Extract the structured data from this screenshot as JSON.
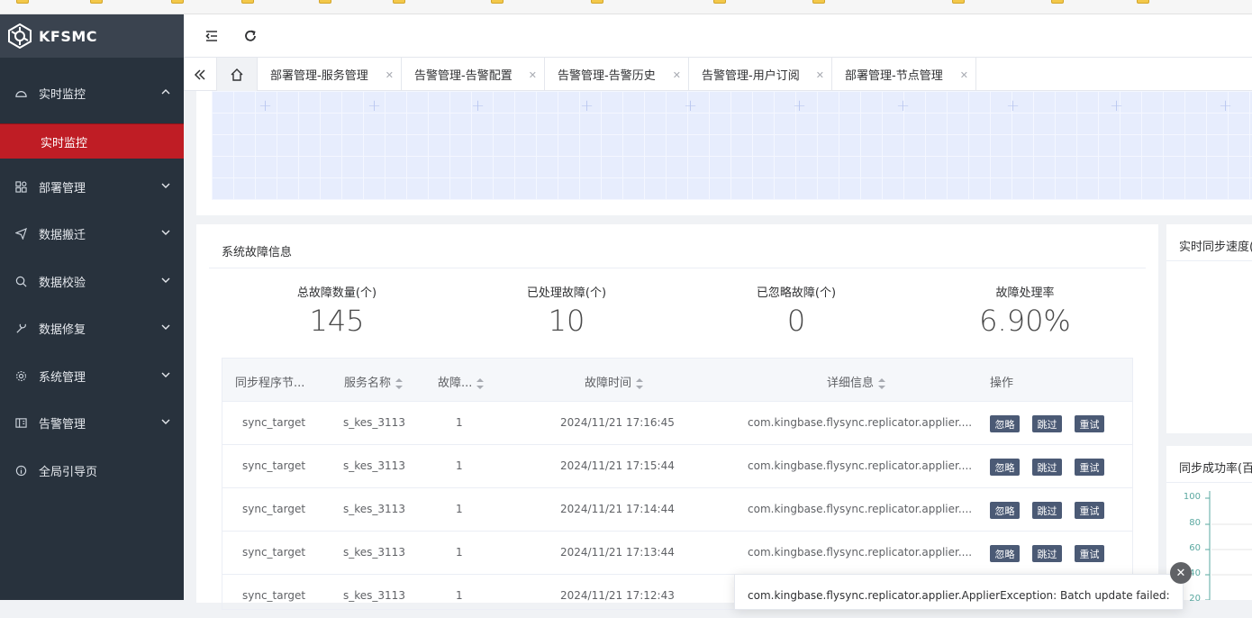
{
  "app": {
    "name": "KFSMC"
  },
  "colors": {
    "sidebar_bg": "#28323d",
    "active_menu": "#bf1d25",
    "button_bg": "#4b5a75"
  },
  "sidebar": {
    "items": [
      {
        "label": "实时监控",
        "icon": "dashboard-icon",
        "expanded": true
      },
      {
        "label": "部署管理",
        "icon": "grid-settings-icon"
      },
      {
        "label": "数据搬迁",
        "icon": "send-icon"
      },
      {
        "label": "数据校验",
        "icon": "search-icon"
      },
      {
        "label": "数据修复",
        "icon": "wrench-icon"
      },
      {
        "label": "系统管理",
        "icon": "gear-icon"
      },
      {
        "label": "告警管理",
        "icon": "alarm-icon"
      },
      {
        "label": "全局引导页",
        "icon": "info-icon"
      }
    ],
    "active_sub": "实时监控"
  },
  "tabs": [
    {
      "label": "部署管理-服务管理"
    },
    {
      "label": "告警管理-告警配置"
    },
    {
      "label": "告警管理-告警历史"
    },
    {
      "label": "告警管理-用户订阅"
    },
    {
      "label": "部署管理-节点管理"
    }
  ],
  "fault_card": {
    "title": "系统故障信息",
    "stats": [
      {
        "label": "总故障数量(个)",
        "value": "145"
      },
      {
        "label": "已处理故障(个)",
        "value": "10"
      },
      {
        "label": "已忽略故障(个)",
        "value": "0"
      },
      {
        "label": "故障处理率",
        "value": "6.90%"
      }
    ],
    "columns": [
      "同步程序节...",
      "服务名称",
      "故障...",
      "故障时间",
      "详细信息",
      "操作"
    ],
    "rows": [
      {
        "node": "sync_target",
        "service": "s_kes_3113",
        "count": "1",
        "time": "2024/11/21 17:16:45",
        "detail": "com.kingbase.flysync.replicator.applier...."
      },
      {
        "node": "sync_target",
        "service": "s_kes_3113",
        "count": "1",
        "time": "2024/11/21 17:15:44",
        "detail": "com.kingbase.flysync.replicator.applier...."
      },
      {
        "node": "sync_target",
        "service": "s_kes_3113",
        "count": "1",
        "time": "2024/11/21 17:14:44",
        "detail": "com.kingbase.flysync.replicator.applier...."
      },
      {
        "node": "sync_target",
        "service": "s_kes_3113",
        "count": "1",
        "time": "2024/11/21 17:13:44",
        "detail": "com.kingbase.flysync.replicator.applier...."
      },
      {
        "node": "sync_target",
        "service": "s_kes_3113",
        "count": "1",
        "time": "2024/11/21 17:12:43",
        "detail": ""
      }
    ],
    "actions": {
      "ignore": "忽略",
      "skip": "跳过",
      "retry": "重试"
    }
  },
  "right_cards": {
    "speed_title": "实时同步速度(",
    "success_title": "同步成功率(百",
    "axis": [
      "100",
      "80",
      "60",
      "40",
      "20"
    ]
  },
  "tooltip": {
    "text": "com.kingbase.flysync.replicator.applier.ApplierException: Batch update failed:"
  }
}
